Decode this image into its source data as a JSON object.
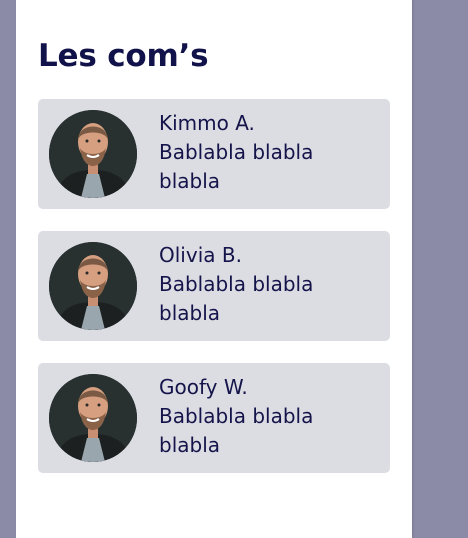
{
  "page": {
    "title": "Les com’s"
  },
  "comments": [
    {
      "author": "Kimmo A.",
      "text": "Bablabla blabla blabla"
    },
    {
      "author": "Olivia B.",
      "text": "Bablabla blabla blabla"
    },
    {
      "author": "Goofy W.",
      "text": "Bablabla blabla blabla"
    }
  ],
  "colors": {
    "backdrop": "#8b8ba8",
    "panel": "#ffffff",
    "card": "#dcdce3",
    "text": "#14144a"
  }
}
